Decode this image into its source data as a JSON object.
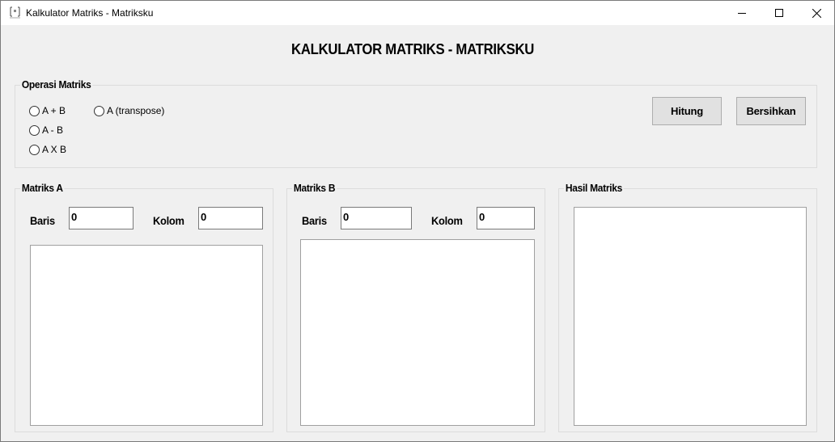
{
  "window": {
    "title": "Kalkulator Matriks - Matriksku"
  },
  "heading": "KALKULATOR MATRIKS - MATRIKSKU",
  "operasi": {
    "title": "Operasi Matriks",
    "options": [
      "A + B",
      "A - B",
      "A X B",
      "A (transpose)"
    ],
    "selected": null
  },
  "buttons": {
    "hitung": "Hitung",
    "bersihkan": "Bersihkan"
  },
  "matriks_a": {
    "title": "Matriks A",
    "baris_label": "Baris",
    "baris_value": "0",
    "kolom_label": "Kolom",
    "kolom_value": "0"
  },
  "matriks_b": {
    "title": "Matriks B",
    "baris_label": "Baris",
    "baris_value": "0",
    "kolom_label": "Kolom",
    "kolom_value": "0"
  },
  "hasil": {
    "title": "Hasil Matriks"
  }
}
